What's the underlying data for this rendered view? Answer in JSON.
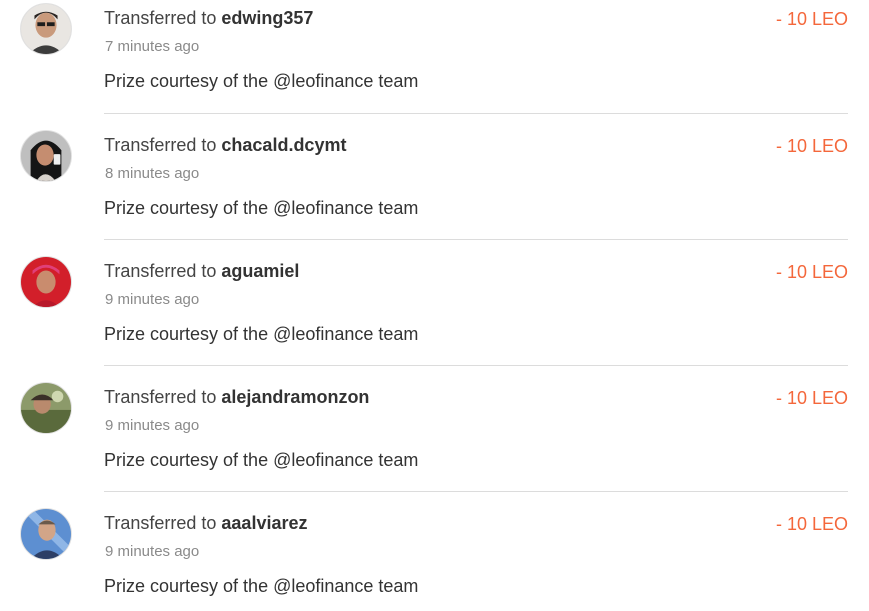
{
  "transfers": [
    {
      "prefix": "Transferred to",
      "user": "edwing357",
      "time": "7 minutes ago",
      "memo": "Prize courtesy of the @leofinance team",
      "amount": "- 10 LEO",
      "avatar": "user-avatar-icon"
    },
    {
      "prefix": "Transferred to",
      "user": "chacald.dcymt",
      "time": "8 minutes ago",
      "memo": "Prize courtesy of the @leofinance team",
      "amount": "- 10 LEO",
      "avatar": "user-avatar-icon"
    },
    {
      "prefix": "Transferred to",
      "user": "aguamiel",
      "time": "9 minutes ago",
      "memo": "Prize courtesy of the @leofinance team",
      "amount": "- 10 LEO",
      "avatar": "user-avatar-icon"
    },
    {
      "prefix": "Transferred to",
      "user": "alejandramonzon",
      "time": "9 minutes ago",
      "memo": "Prize courtesy of the @leofinance team",
      "amount": "- 10 LEO",
      "avatar": "user-avatar-icon"
    },
    {
      "prefix": "Transferred to",
      "user": "aaalviarez",
      "time": "9 minutes ago",
      "memo": "Prize courtesy of the @leofinance team",
      "amount": "- 10 LEO",
      "avatar": "user-avatar-icon"
    }
  ],
  "colors": {
    "amount": "#f4673b",
    "divider": "#dcdcdc",
    "timestamp": "#8a8a8a",
    "text": "#333333"
  }
}
